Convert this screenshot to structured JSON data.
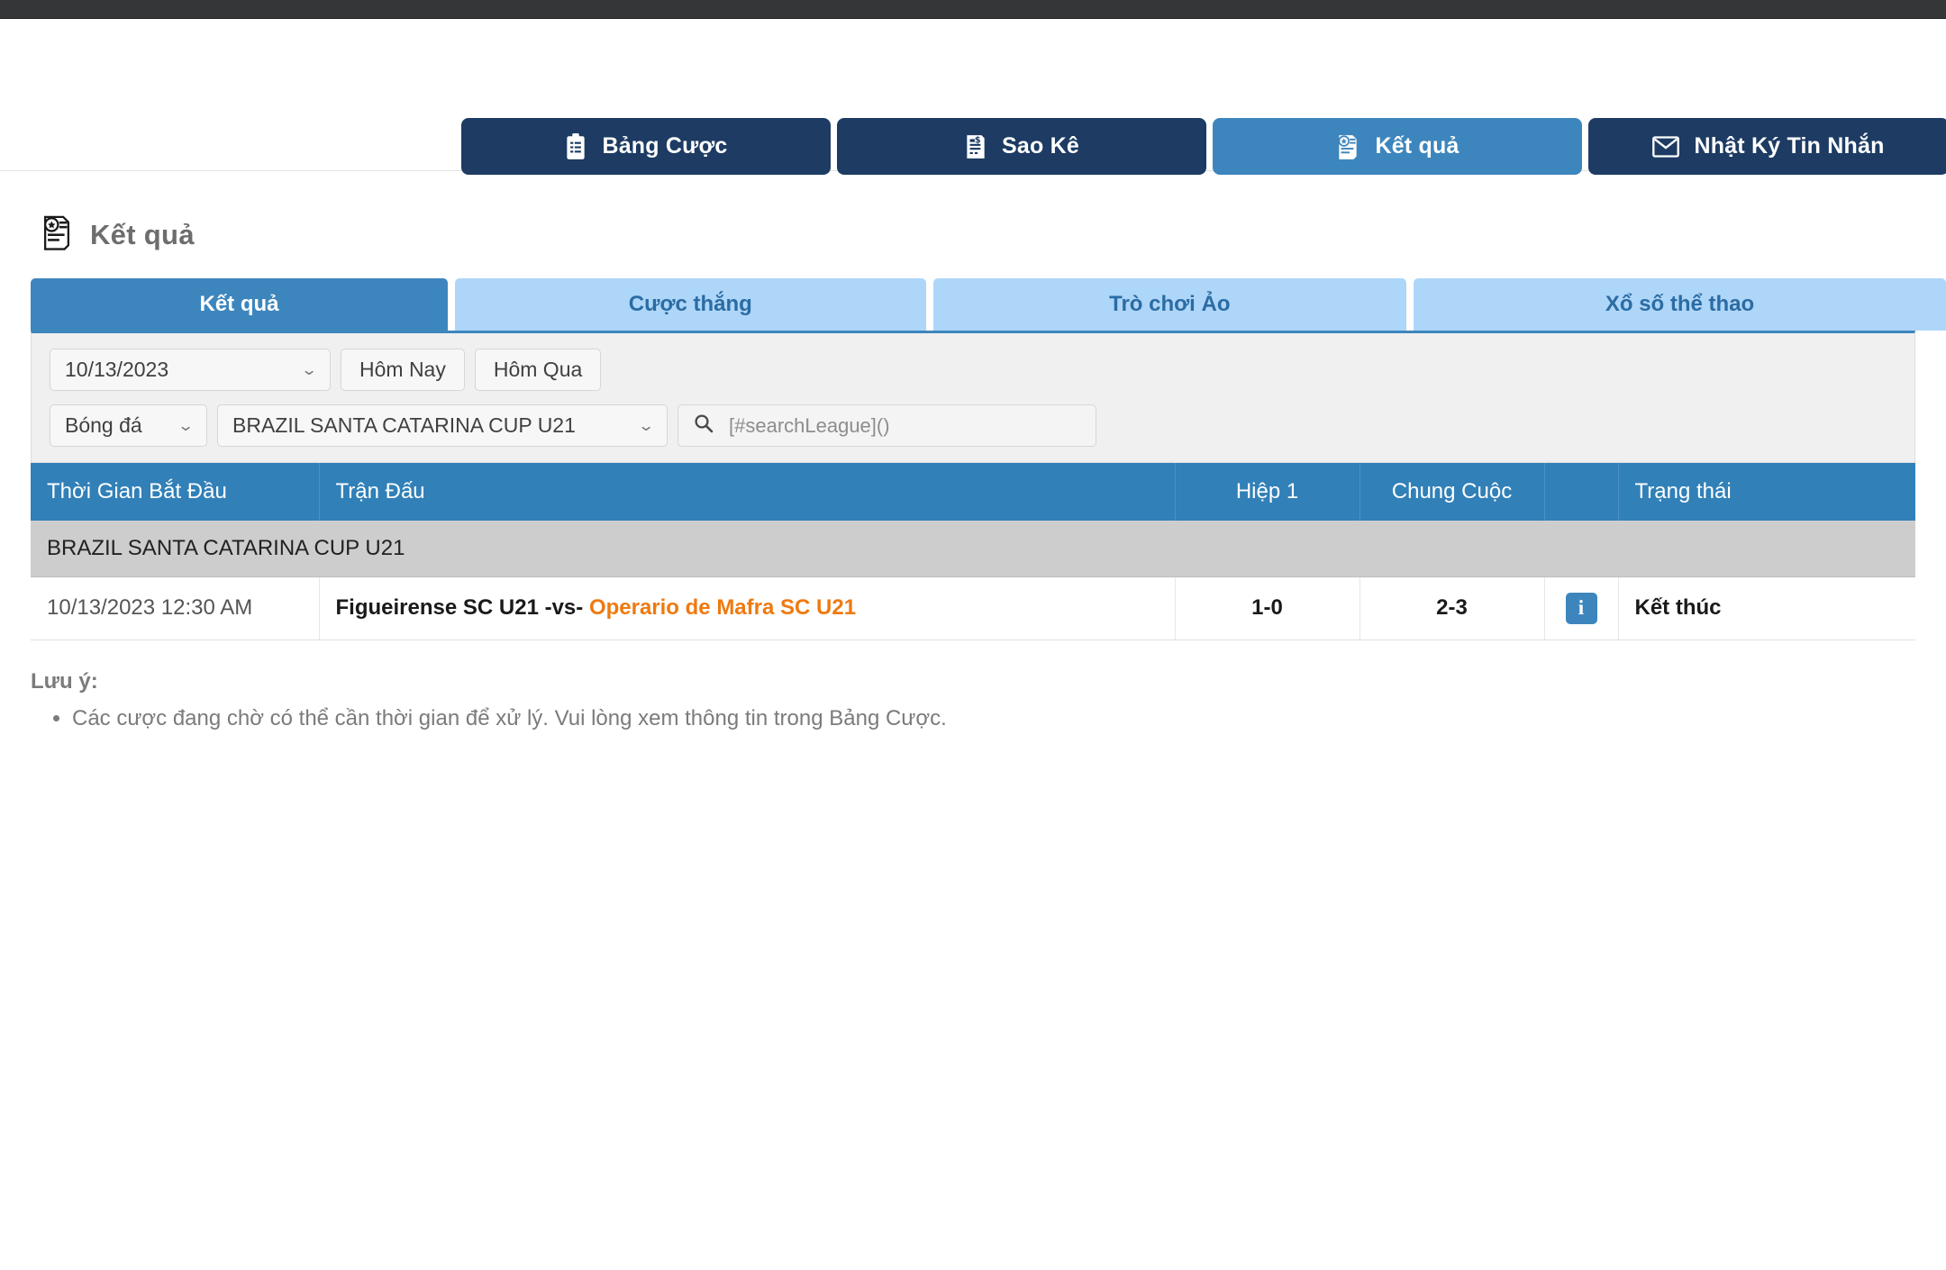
{
  "nav": {
    "buttons": [
      {
        "label": "Bảng Cược",
        "icon": "clipboard-icon",
        "active": false
      },
      {
        "label": "Sao Kê",
        "icon": "statement-icon",
        "active": false
      },
      {
        "label": "Kết quả",
        "icon": "results-icon",
        "active": true
      },
      {
        "label": "Nhật Ký Tin Nhắn",
        "icon": "envelope-icon",
        "active": false
      }
    ]
  },
  "page": {
    "title": "Kết quả",
    "icon": "results-icon"
  },
  "subtabs": [
    {
      "label": "Kết quả",
      "active": true
    },
    {
      "label": "Cược thắng",
      "active": false
    },
    {
      "label": "Trò chơi Ảo",
      "active": false
    },
    {
      "label": "Xổ số thể thao",
      "active": false
    }
  ],
  "filters": {
    "date_value": "10/13/2023",
    "today_label": "Hôm Nay",
    "yesterday_label": "Hôm Qua",
    "sport_value": "Bóng đá",
    "league_value": "BRAZIL SANTA CATARINA CUP U21",
    "search_placeholder": "[#searchLeague]()",
    "search_value": "",
    "search_icon": "search-icon",
    "chevron": "⌄"
  },
  "table": {
    "headers": {
      "time": "Thời Gian Bắt Đầu",
      "match": "Trận Đấu",
      "half1": "Hiệp 1",
      "fulltime": "Chung Cuộc",
      "info": "",
      "status": "Trạng thái"
    },
    "groups": [
      {
        "league": "BRAZIL SANTA CATARINA CUP U21",
        "rows": [
          {
            "time": "10/13/2023 12:30 AM",
            "home": "Figueirense SC U21",
            "separator": " -vs- ",
            "away": "Operario de Mafra SC U21",
            "half1": "1-0",
            "fulltime": "2-3",
            "info_icon": "info-icon",
            "status": "Kết thúc"
          }
        ]
      }
    ]
  },
  "note": {
    "title": "Lưu ý:",
    "items": [
      "Các cược đang chờ có thể cần thời gian để xử lý. Vui lòng xem thông tin trong Bảng Cược."
    ]
  },
  "colors": {
    "nav_dark": "#1d3b63",
    "nav_active": "#3d86bd",
    "tab_light": "#aed6f9",
    "table_header": "#3180b8",
    "league_row": "#cdcdcd",
    "away_team": "#ee7a10",
    "topbar": "#343638"
  }
}
